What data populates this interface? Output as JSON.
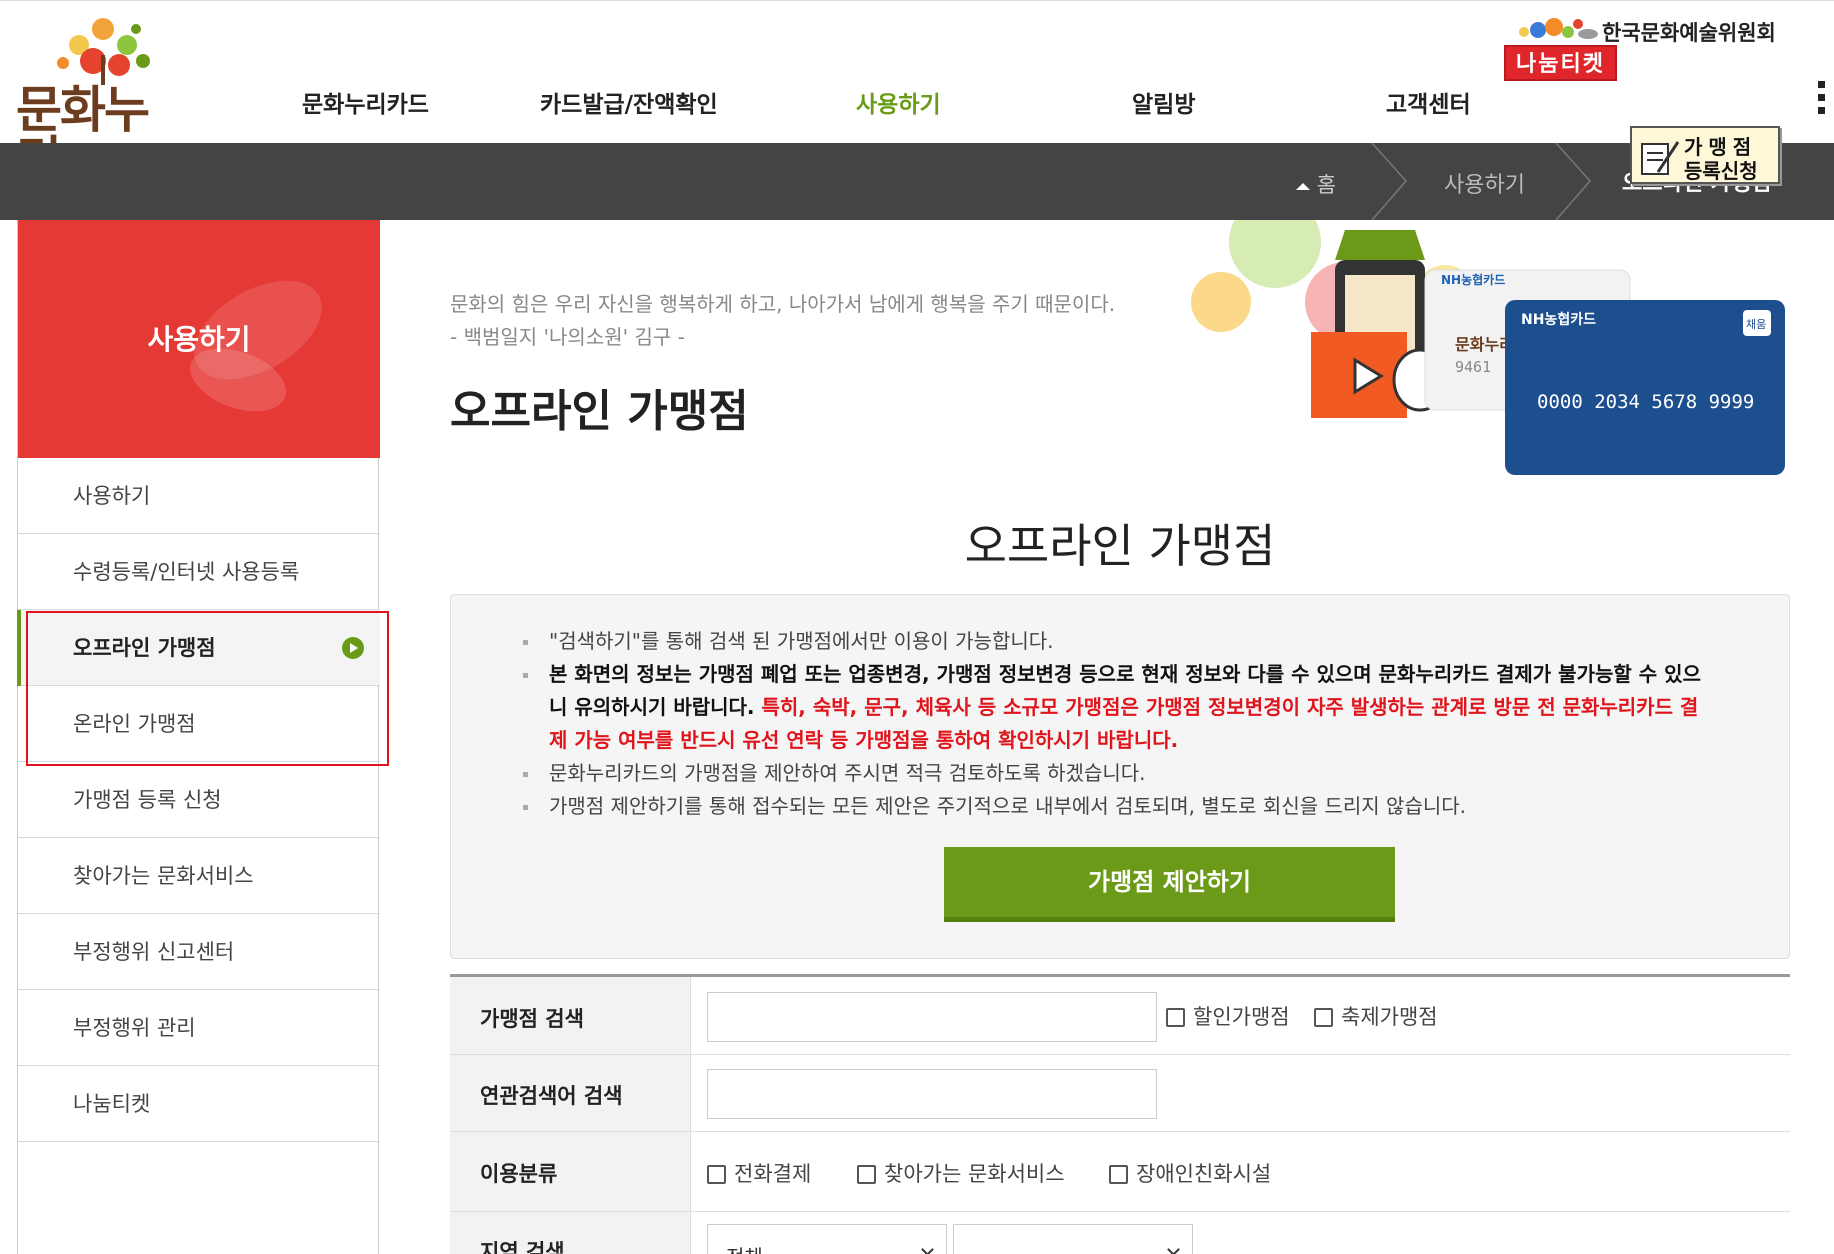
{
  "header": {
    "logo_text": "문화누리",
    "nav": [
      {
        "label": "문화누리카드"
      },
      {
        "label": "카드발급/잔액확인"
      },
      {
        "label": "사용하기",
        "active": true
      },
      {
        "label": "알림방"
      },
      {
        "label": "고객센터"
      }
    ],
    "org_label": "한국문화예술위원회",
    "share_ticket": "나눔티켓"
  },
  "breadcrumb": {
    "home": "홈",
    "level1": "사용하기",
    "current": "오프라인 가맹점"
  },
  "apply_badge": {
    "line1": "가맹점",
    "line2": "등록신청"
  },
  "sidebar": {
    "title": "사용하기",
    "items": [
      {
        "label": "사용하기"
      },
      {
        "label": "수령등록/인터넷 사용등록"
      },
      {
        "label": "오프라인 가맹점",
        "active": true
      },
      {
        "label": "온라인 가맹점"
      },
      {
        "label": "가맹점 등록 신청"
      },
      {
        "label": "찾아가는 문화서비스"
      },
      {
        "label": "부정행위 신고센터"
      },
      {
        "label": "부정행위 관리"
      },
      {
        "label": "나눔티켓"
      }
    ]
  },
  "main": {
    "quote": "문화의 힘은 우리 자신을 행복하게 하고, 나아가서 남에게 행복을 주기 때문이다.",
    "quote_source": "- 백범일지 '나의소원' 김구 -",
    "page_title": "오프라인 가맹점",
    "section_title": "오프라인 가맹점",
    "hero_cards": {
      "card_brand": "NH농협카드",
      "card_number": "0000 2034 5678 9999",
      "card_tag": "채움",
      "card_logo": "문화누리",
      "card_partial": "9461"
    },
    "notice": {
      "item1": "\"검색하기\"를 통해 검색 된 가맹점에서만 이용이 가능합니다.",
      "item2_bold": "본 화면의 정보는 가맹점 폐업 또는 업종변경, 가맹점 정보변경 등으로 현재 정보와 다를 수 있으며 문화누리카드 결제가 불가능할 수 있으니 유의하시기 바랍니다.",
      "item2_red": " 특히, 숙박, 문구, 체육사 등 소규모 가맹점은 가맹점 정보변경이 자주 발생하는 관계로 방문 전 문화누리카드 결제 가능 여부를 반드시 유선 연락 등 가맹점을 통하여 확인하시기 바랍니다.",
      "item3": "문화누리카드의 가맹점을 제안하여 주시면 적극 검토하도록 하겠습니다.",
      "item4": "가맹점 제안하기를 통해 접수되는 모든 제안은 주기적으로 내부에서 검토되며, 별도로 회신을 드리지 않습니다.",
      "button": "가맹점 제안하기"
    },
    "search": {
      "row1_label": "가맹점 검색",
      "row1_value": "",
      "chk_discount": "할인가맹점",
      "chk_festival": "축제가맹점",
      "row2_label": "연관검색어 검색",
      "row2_value": "",
      "row3_label": "이용분류",
      "chk_phone": "전화결제",
      "chk_visit": "찾아가는 문화서비스",
      "chk_accessible": "장애인친화시설",
      "row4_label": "지역 검색",
      "region_select": "전체",
      "subregion_select": ""
    }
  },
  "colors": {
    "accent_green": "#6a9a17",
    "sidebar_red": "#e53935",
    "notice_red": "#e0151c",
    "crumbbar": "#444444"
  }
}
